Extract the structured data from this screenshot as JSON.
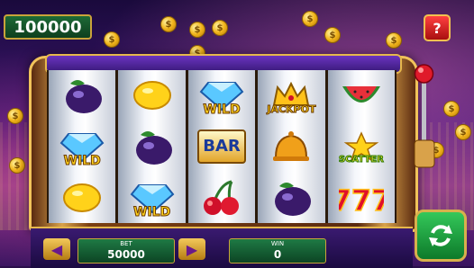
{
  "balance": "100000",
  "help_label": "?",
  "coin_symbol": "$",
  "reels": [
    [
      {
        "sym": "plum"
      },
      {
        "sym": "diamond",
        "label": "WILD"
      },
      {
        "sym": "lemon"
      }
    ],
    [
      {
        "sym": "lemon"
      },
      {
        "sym": "plum"
      },
      {
        "sym": "diamond",
        "label": "WILD"
      }
    ],
    [
      {
        "sym": "diamond",
        "label": "WILD"
      },
      {
        "sym": "bar",
        "label": "BAR"
      },
      {
        "sym": "cherry"
      }
    ],
    [
      {
        "sym": "crown",
        "label": "JACKPOT"
      },
      {
        "sym": "bell"
      },
      {
        "sym": "plum"
      }
    ],
    [
      {
        "sym": "watermelon"
      },
      {
        "sym": "star",
        "label": "SCATTER"
      },
      {
        "sym": "seven"
      }
    ]
  ],
  "bet": {
    "label": "BET",
    "value": "50000"
  },
  "win": {
    "label": "WIN",
    "value": "0"
  },
  "icons": {
    "prev": "arrow-left-icon",
    "next": "arrow-right-icon",
    "spin": "refresh-icon"
  }
}
